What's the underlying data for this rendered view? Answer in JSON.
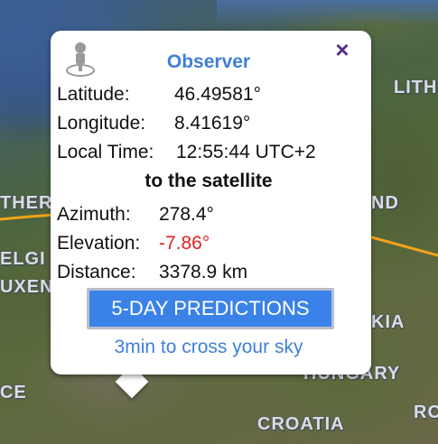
{
  "map": {
    "labels": {
      "lithuania": "LITH",
      "netherlands": "THER",
      "poland": "ND",
      "belgium": "ELGI",
      "luxembourg": "UXEN",
      "slovakia": "KIA",
      "hungary": "HUNGARY",
      "france": "CE",
      "croatia": "CROATIA",
      "romania": "RO"
    },
    "orbit_color": "#f5a11a"
  },
  "popup": {
    "title": "Observer",
    "close_label": "×",
    "latitude_label": "Latitude:",
    "latitude_value": "46.49581°",
    "longitude_label": "Longitude:",
    "longitude_value": "8.41619°",
    "local_time_label": "Local Time:",
    "local_time_value": "12:55:44 UTC+2",
    "section_title": "to the satellite",
    "azimuth_label": "Azimuth:",
    "azimuth_value": "278.4°",
    "elevation_label": "Elevation:",
    "elevation_value": "-7.86°",
    "distance_label": "Distance:",
    "distance_value": "3378.9 km",
    "predictions_button": "5-DAY PREDICTIONS",
    "cross_sky_link": "3min to cross your sky",
    "observer_icon": "observer-pin-icon",
    "colors": {
      "accent": "#3f7fd8",
      "button": "#3b82e8",
      "close": "#5b2c8a",
      "negative": "#e32020"
    }
  }
}
